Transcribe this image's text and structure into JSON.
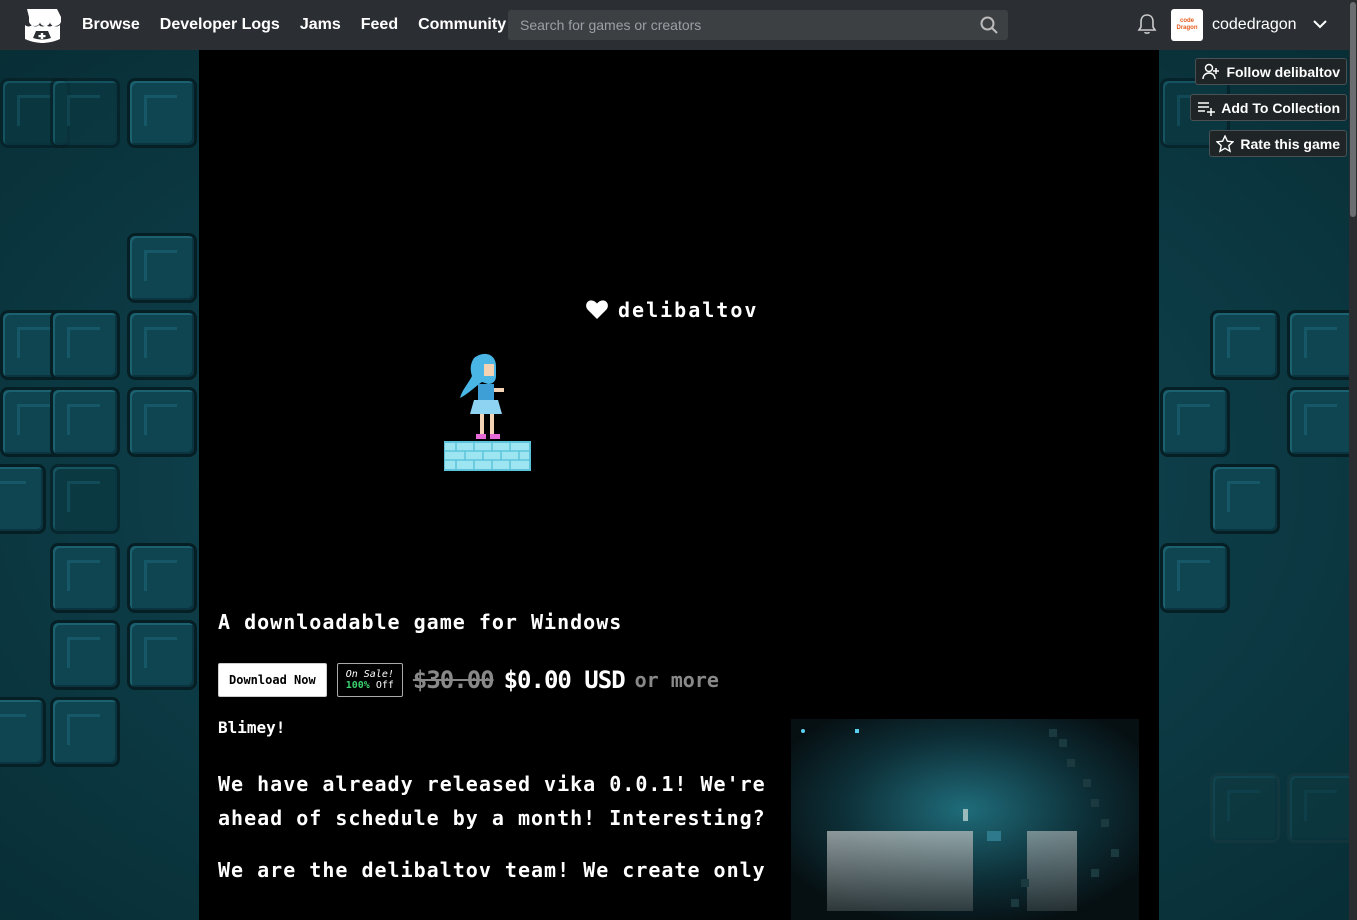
{
  "nav": {
    "items": [
      {
        "label": "Browse"
      },
      {
        "label": "Developer Logs"
      },
      {
        "label": "Jams"
      },
      {
        "label": "Feed"
      },
      {
        "label": "Community"
      }
    ],
    "search_placeholder": "Search for games or creators",
    "username": "codedragon",
    "avatar_text_1": "code",
    "avatar_text_2": "Dragon"
  },
  "actions": {
    "follow": "Follow delibaltov",
    "collection": "Add To Collection",
    "rate": "Rate this game"
  },
  "banner": {
    "brand": "delibaltov"
  },
  "game": {
    "tagline": "A downloadable game for Windows",
    "download_label": "Download Now",
    "sale_line1": "On Sale!",
    "sale_pct": "100%",
    "sale_off": "Off",
    "old_price": "$30.00",
    "new_price": "$0.00 USD",
    "or_more": "or more"
  },
  "description": {
    "heading": "Blimey!",
    "paragraphs": [
      "We have already released vika 0.0.1! We're ahead of schedule by a month! Interesting?",
      "We are the delibaltov team! We create only"
    ]
  },
  "colors": {
    "topbar": "#2b2f33",
    "background": "#0e3a45",
    "sale_green": "#3bd16f"
  }
}
